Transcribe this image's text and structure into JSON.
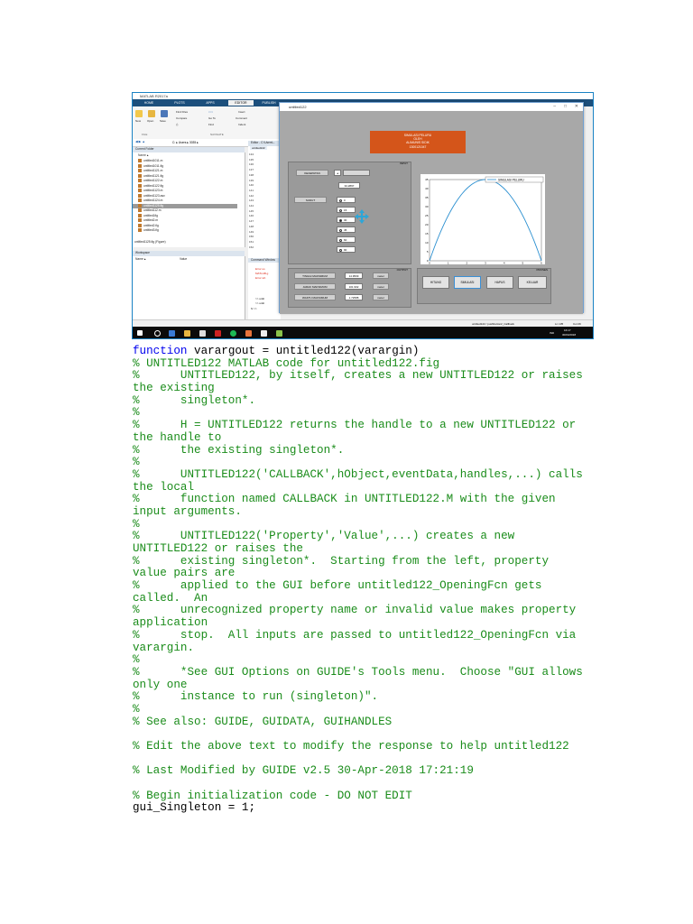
{
  "screenshot": {
    "matlab_title": "MATLAB R2017a",
    "tabs": [
      "HOME",
      "PLOTS",
      "APPS",
      "EDITOR",
      "PUBLISH",
      "VIEW"
    ],
    "ribbon": {
      "new": "New",
      "open": "Open",
      "save": "Save",
      "find_files": "Find Files",
      "compare": "Compare",
      "go_to": "Go To",
      "find": "Find",
      "insert": "Insert",
      "comment": "Comment",
      "indent": "Indent",
      "file_group": "FILE",
      "navigate_group": "NAVIGATE"
    },
    "path": "C: ▸ Users ▸ 3035 ▸",
    "current_folder_label": "Current Folder",
    "name_col": "Name ▴",
    "files": [
      "untitled1011.m",
      "untitled1011.fig",
      "untitled1121.m",
      "untitled1121.fig",
      "untitled1122.m",
      "untitled1122.fig",
      "untitled1123.m",
      "untitled1123.asv",
      "untitled1124.m",
      "untitled1125.fig",
      "untitled112.m",
      "untitled1fig",
      "untitled2.m",
      "untitled2.fig",
      "untitled3.fig"
    ],
    "selected_file": "untitled1125.fig",
    "details_text": "untitled1125.fig (Figure)",
    "workspace_label": "Workspace",
    "ws_name": "Name ▴",
    "ws_value": "Value",
    "editor_label": "Editor - C:\\Users\\...",
    "editor_tab": "untitled122",
    "line_numbers": [
      "134",
      "135",
      "136",
      "137",
      "138",
      "139",
      "140",
      "141",
      "142",
      "143",
      "144",
      "145",
      "146",
      "147",
      "148",
      "149",
      "150",
      "151",
      "152"
    ],
    "cw_label": "Command Window",
    "cw_lines": [
      "Error us",
      "MATLAB.g",
      "Error wh",
      ">> untit",
      ">> untit",
      "fx >>"
    ],
    "status_text": "untitled122 / pushbutton2_Callback",
    "status_ln": "Ln 135",
    "status_col": "Col 29",
    "taskbar_lang": "IND",
    "taskbar_time": "16:17",
    "taskbar_date": "30/04/2018",
    "gui": {
      "title": "untitled122",
      "banner_lines": [
        "SIMULASI PELURU",
        "OLEH",
        "ALIMUNIS SIDIK",
        "1300121047"
      ],
      "input_title": "INPUT",
      "kecepatan_label": "KECEPATAN",
      "kecepatan_value": "34.2897",
      "sudut_label": "SUDUT",
      "angles": [
        "0",
        "15",
        "30",
        "45",
        "60",
        "90"
      ],
      "selected_angle": "30",
      "output_title": "OUTPUT",
      "outputs": [
        {
          "label": "TINGGI MAKSIMUM",
          "value": "14.9509",
          "unit": "meter"
        },
        {
          "label": "JARAK MAKSIMUM",
          "value": "101.902",
          "unit": "meter"
        },
        {
          "label": "WAKTU MAKSIMUM",
          "value": "1.72588",
          "unit": "meter"
        }
      ],
      "process_title": "PROSES",
      "buttons": [
        "HITUNG",
        "SIMULASI",
        "HAPUS",
        "KELUAR"
      ],
      "legend": "SIMULASI PELURU",
      "y_ticks": [
        "0",
        "5",
        "10",
        "15",
        "20",
        "25",
        "30",
        "35",
        "40",
        "45"
      ],
      "x_ticks": [
        "0",
        "1",
        "2",
        "3",
        "4",
        "5",
        "6"
      ]
    }
  },
  "code_lines": [
    {
      "t": "function varargout = untitled122(varargin)",
      "k": "fn"
    },
    {
      "t": "% UNTITLED122 MATLAB code for untitled122.fig",
      "k": "c"
    },
    {
      "t": "%      UNTITLED122, by itself, creates a new UNTITLED122 or raises",
      "k": "c"
    },
    {
      "t": "the existing",
      "k": "c"
    },
    {
      "t": "%      singleton*.",
      "k": "c"
    },
    {
      "t": "%",
      "k": "c"
    },
    {
      "t": "%      H = UNTITLED122 returns the handle to a new UNTITLED122 or",
      "k": "c"
    },
    {
      "t": "the handle to",
      "k": "c"
    },
    {
      "t": "%      the existing singleton*.",
      "k": "c"
    },
    {
      "t": "%",
      "k": "c"
    },
    {
      "t": "%      UNTITLED122('CALLBACK',hObject,eventData,handles,...) calls",
      "k": "c"
    },
    {
      "t": "the local",
      "k": "c"
    },
    {
      "t": "%      function named CALLBACK in UNTITLED122.M with the given",
      "k": "c"
    },
    {
      "t": "input arguments.",
      "k": "c"
    },
    {
      "t": "%",
      "k": "c"
    },
    {
      "t": "%      UNTITLED122('Property','Value',...) creates a new",
      "k": "c"
    },
    {
      "t": "UNTITLED122 or raises the",
      "k": "c"
    },
    {
      "t": "%      existing singleton*.  Starting from the left, property",
      "k": "c"
    },
    {
      "t": "value pairs are",
      "k": "c"
    },
    {
      "t": "%      applied to the GUI before untitled122_OpeningFcn gets",
      "k": "c"
    },
    {
      "t": "called.  An",
      "k": "c"
    },
    {
      "t": "%      unrecognized property name or invalid value makes property",
      "k": "c"
    },
    {
      "t": "application",
      "k": "c"
    },
    {
      "t": "%      stop.  All inputs are passed to untitled122_OpeningFcn via",
      "k": "c"
    },
    {
      "t": "varargin.",
      "k": "c"
    },
    {
      "t": "%",
      "k": "c"
    },
    {
      "t": "%      *See GUI Options on GUIDE's Tools menu.  Choose \"GUI allows",
      "k": "c"
    },
    {
      "t": "only one",
      "k": "c"
    },
    {
      "t": "%      instance to run (singleton)\".",
      "k": "c"
    },
    {
      "t": "%",
      "k": "c"
    },
    {
      "t": "% See also: GUIDE, GUIDATA, GUIHANDLES",
      "k": "c"
    },
    {
      "t": "",
      "k": "b"
    },
    {
      "t": "% Edit the above text to modify the response to help untitled122",
      "k": "c"
    },
    {
      "t": "",
      "k": "b"
    },
    {
      "t": "% Last Modified by GUIDE v2.5 30-Apr-2018 17:21:19",
      "k": "c"
    },
    {
      "t": "",
      "k": "b"
    },
    {
      "t": "% Begin initialization code - DO NOT EDIT",
      "k": "c"
    },
    {
      "t": "gui_Singleton = 1;",
      "k": "n"
    }
  ]
}
